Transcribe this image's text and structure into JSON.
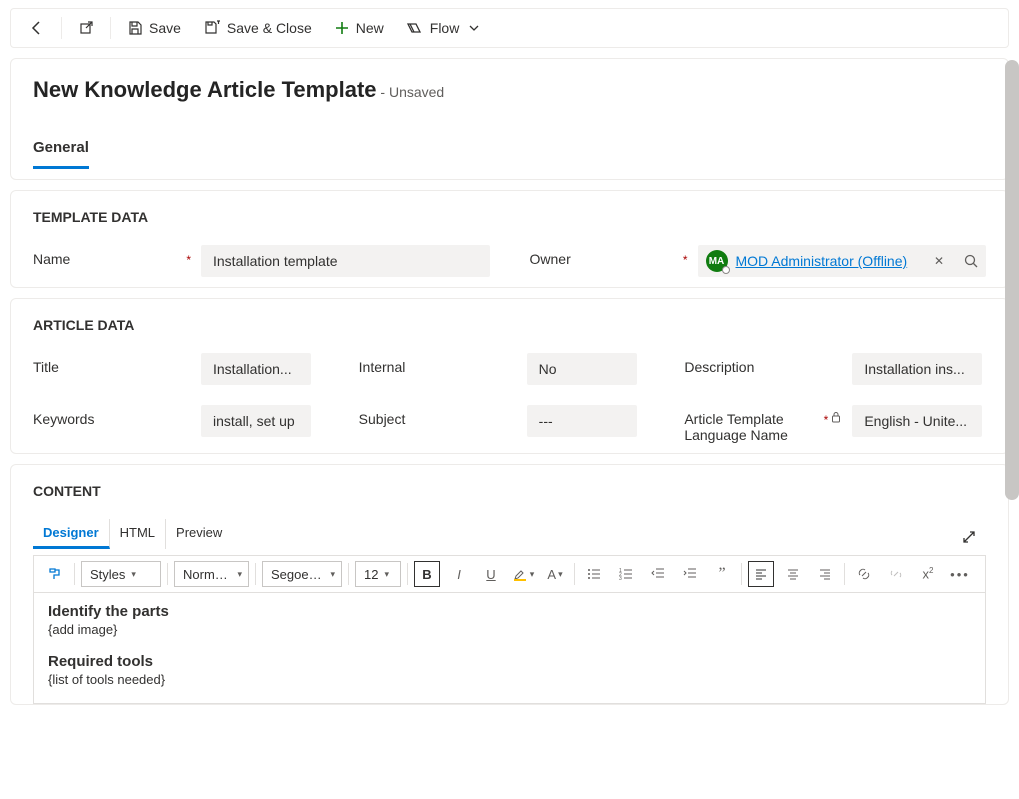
{
  "toolbar": {
    "save_label": "Save",
    "save_close_label": "Save & Close",
    "new_label": "New",
    "flow_label": "Flow"
  },
  "header": {
    "page_title": "New Knowledge Article Template",
    "unsaved_label": "- Unsaved",
    "tabs": {
      "general": "General"
    }
  },
  "sections": {
    "template_data_heading": "TEMPLATE DATA",
    "article_data_heading": "ARTICLE DATA",
    "content_heading": "CONTENT"
  },
  "template_data": {
    "name_label": "Name",
    "name_value": "Installation template",
    "owner_label": "Owner",
    "owner_value": "MOD Administrator (Offline)",
    "owner_initials": "MA"
  },
  "article_data": {
    "title_label": "Title",
    "title_value": "Installation...",
    "internal_label": "Internal",
    "internal_value": "No",
    "description_label": "Description",
    "description_value": "Installation ins...",
    "keywords_label": "Keywords",
    "keywords_value": "install, set up",
    "subject_label": "Subject",
    "subject_value": "---",
    "language_label": "Article Template Language Name",
    "language_value": "English - Unite..."
  },
  "content": {
    "tabs": {
      "designer": "Designer",
      "html": "HTML",
      "preview": "Preview"
    },
    "rte": {
      "styles": "Styles",
      "format": "Normal (...",
      "font": "Segoe UI",
      "size": "12"
    },
    "body": {
      "h1": "Identify the parts",
      "p1": "{add image}",
      "h2": "Required tools",
      "p2": "{list of tools needed}"
    }
  }
}
